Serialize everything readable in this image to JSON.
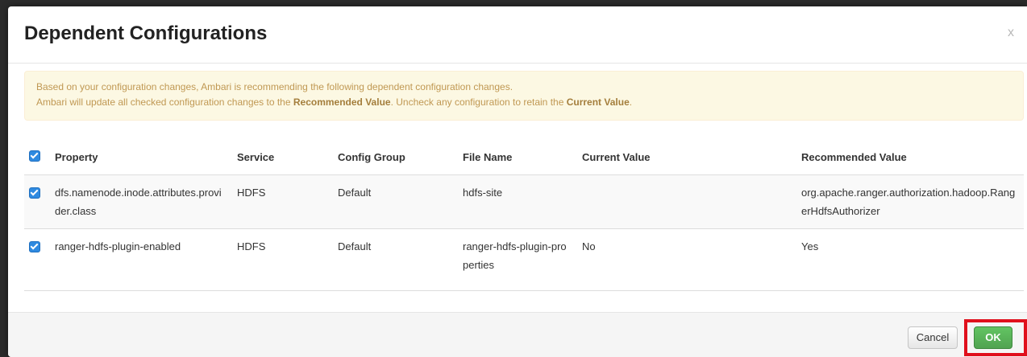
{
  "dialog": {
    "title": "Dependent Configurations",
    "close_label": "x"
  },
  "alert": {
    "line1": "Based on your configuration changes, Ambari is recommending the following dependent configuration changes.",
    "line2_pre": "Ambari will update all checked configuration changes to the ",
    "line2_bold1": "Recommended Value",
    "line2_mid": ". Uncheck any configuration to retain the ",
    "line2_bold2": "Current Value",
    "line2_post": "."
  },
  "table": {
    "headers": {
      "property": "Property",
      "service": "Service",
      "config_group": "Config Group",
      "file_name": "File Name",
      "current_value": "Current Value",
      "recommended_value": "Recommended Value"
    },
    "header_checked": true,
    "rows": [
      {
        "checked": true,
        "property": "dfs.namenode.inode.attributes.provider.class",
        "service": "HDFS",
        "config_group": "Default",
        "file_name": "hdfs-site",
        "current_value": "",
        "recommended_value": "org.apache.ranger.authorization.hadoop.RangerHdfsAuthorizer"
      },
      {
        "checked": true,
        "property": "ranger-hdfs-plugin-enabled",
        "service": "HDFS",
        "config_group": "Default",
        "file_name": "ranger-hdfs-plugin-properties",
        "current_value": "No",
        "recommended_value": "Yes"
      }
    ]
  },
  "footer": {
    "cancel_label": "Cancel",
    "ok_label": "OK"
  },
  "colors": {
    "ok_button": "#5bb75b",
    "highlight_box": "#e0101c",
    "checkbox": "#2f8ae0",
    "alert_bg": "#fcf8e3"
  }
}
